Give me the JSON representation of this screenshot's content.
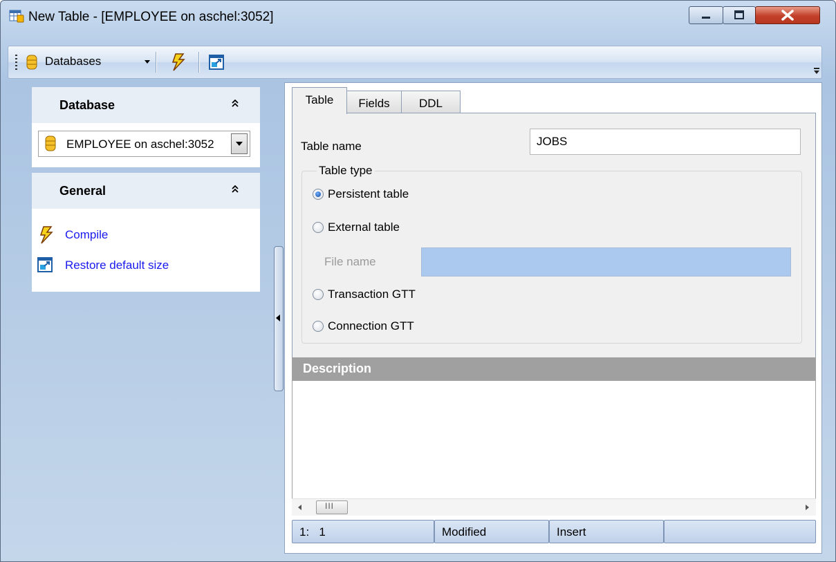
{
  "window": {
    "title": "New Table - [EMPLOYEE on aschel:3052]"
  },
  "toolbar": {
    "databases_label": "Databases",
    "compile_icon": "lightning-icon",
    "restore_icon": "restore-size-icon"
  },
  "sidebar": {
    "database_group": {
      "title": "Database",
      "selected_database": "EMPLOYEE on aschel:3052"
    },
    "general_group": {
      "title": "General",
      "items": [
        {
          "label": "Compile",
          "icon": "lightning-icon"
        },
        {
          "label": "Restore default size",
          "icon": "restore-size-icon"
        }
      ]
    }
  },
  "tabs": [
    {
      "label": "Table",
      "active": true
    },
    {
      "label": "Fields",
      "active": false
    },
    {
      "label": "DDL",
      "active": false
    }
  ],
  "table_page": {
    "table_name_label": "Table name",
    "table_name_value": "JOBS",
    "table_type_legend": "Table type",
    "options": [
      {
        "label": "Persistent table",
        "checked": true
      },
      {
        "label": "External table",
        "checked": false
      },
      {
        "label": "Transaction GTT",
        "checked": false
      },
      {
        "label": "Connection GTT",
        "checked": false
      }
    ],
    "file_name_label": "File name",
    "file_name_value": ""
  },
  "description": {
    "title": "Description",
    "text": ""
  },
  "statusbar": {
    "position": "1:   1",
    "state": "Modified",
    "mode": "Insert",
    "extra": ""
  },
  "colors": {
    "window_frame": "#b9cfe8",
    "close_button": "#c2402a",
    "link": "#1a1aee",
    "description_header": "#a0a0a0",
    "file_name_disabled": "#abc8ee"
  }
}
